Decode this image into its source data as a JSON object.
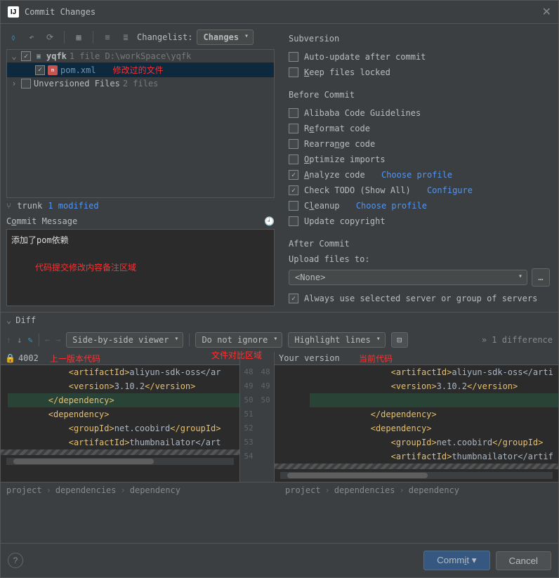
{
  "window": {
    "title": "Commit Changes"
  },
  "toolbar": {
    "changelist_label": "Changelist:",
    "changelist_value": "Changes"
  },
  "tree": {
    "root": {
      "name": "yqfk",
      "meta": "1 file  D:\\workSpace\\yqfk"
    },
    "file": {
      "name": "pom.xml",
      "annotation": "修改过的文件"
    },
    "unversioned": {
      "name": "Unversioned Files",
      "meta": "2 files"
    }
  },
  "branch": {
    "name": "trunk",
    "modified": "1 modified"
  },
  "commit_message": {
    "label_pre": "C",
    "label_u": "o",
    "label_post": "mmit Message",
    "text": "添加了pom依赖",
    "red_note": "代码提交修改内容备注区域"
  },
  "subversion": {
    "title": "Subversion",
    "auto_update": "Auto-update after commit",
    "keep_locked_pre": "",
    "keep_locked_u": "K",
    "keep_locked_post": "eep files locked"
  },
  "before_commit": {
    "title": "Before Commit",
    "alibaba": "Alibaba Code Guidelines",
    "reformat_pre": "R",
    "reformat_u": "e",
    "reformat_post": "format code",
    "rearrange_pre": "Rearra",
    "rearrange_u": "n",
    "rearrange_post": "ge code",
    "optimize_pre": "",
    "optimize_u": "O",
    "optimize_post": "ptimize imports",
    "analyze_pre": "",
    "analyze_u": "A",
    "analyze_post": "nalyze code",
    "choose_profile": "Choose profile",
    "check_todo": "Check TODO (Show All)",
    "configure": "Configure",
    "cleanup_pre": "C",
    "cleanup_u": "l",
    "cleanup_post": "eanup",
    "update_copyright": "Update copyright"
  },
  "after_commit": {
    "title": "After Commit",
    "upload_label": "Upload files to:",
    "upload_value": "<None>",
    "always_use": "Always use selected server or group of servers"
  },
  "diff": {
    "header": "Diff",
    "viewer_mode": "Side-by-side viewer",
    "ignore_mode": "Do not ignore",
    "highlight_mode": "Highlight lines",
    "difference_count": "1 difference",
    "left_header_num": "4002",
    "right_header": "Your version",
    "anno_left": "上一版本代码",
    "anno_center": "文件对比区域",
    "anno_right": "当前代码",
    "left_lines": [
      {
        "ln": "",
        "content": "            <artifactId>aliyun-sdk-oss</ar"
      },
      {
        "ln": "",
        "content": "            <version>3.10.2</version>"
      },
      {
        "ln": "",
        "content": "        </dependency>",
        "hl": true
      },
      {
        "ln": "",
        "content": "        <dependency>"
      },
      {
        "ln": "",
        "content": "            <groupId>net.coobird</groupId>"
      },
      {
        "ln": "",
        "content": "            <artifactId>thumbnailator</art"
      }
    ],
    "right_lines": [
      {
        "ln": "48",
        "content": "                <artifactId>aliyun-sdk-oss</arti"
      },
      {
        "ln": "49",
        "content": "                <version>3.10.2</version>"
      },
      {
        "ln": "50",
        "content": "",
        "hl": true
      },
      {
        "ln": "51",
        "content": "            </dependency>"
      },
      {
        "ln": "52",
        "content": "            <dependency>"
      },
      {
        "ln": "53",
        "content": "                <groupId>net.coobird</groupId>"
      },
      {
        "ln": "54",
        "content": "                <artifactId>thumbnailator</artif"
      }
    ],
    "center_pairs": [
      [
        "48",
        "48"
      ],
      [
        "49",
        "49"
      ],
      [
        "50",
        "50"
      ],
      [
        "51",
        ""
      ],
      [
        "52",
        ""
      ],
      [
        "53",
        ""
      ],
      [
        "54",
        ""
      ]
    ],
    "breadcrumb": [
      "project",
      "dependencies",
      "dependency"
    ]
  },
  "footer": {
    "commit_pre": "Comm",
    "commit_u": "i",
    "commit_post": "t",
    "cancel": "Cancel"
  }
}
